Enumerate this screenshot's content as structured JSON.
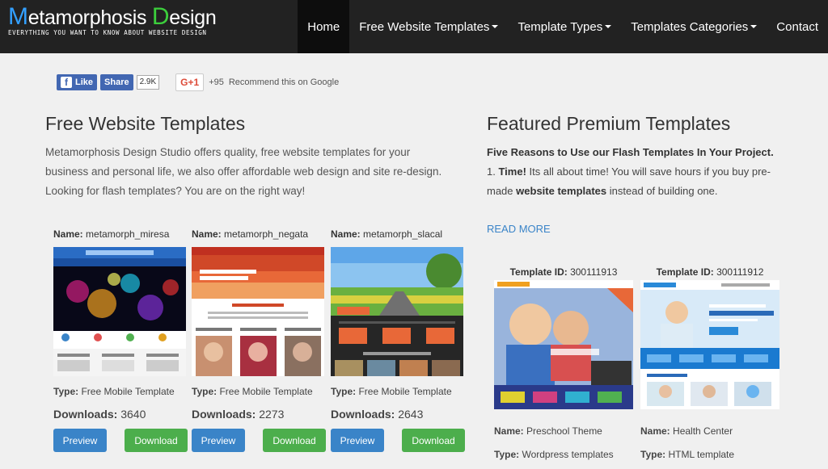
{
  "header": {
    "logo_m": "M",
    "logo_rest1": "etamorphosis ",
    "logo_d": "D",
    "logo_rest2": "esign",
    "tagline": "EVERYTHING YOU WANT TO KNOW ABOUT WEBSITE DESIGN",
    "nav": {
      "home": "Home",
      "free_templates": "Free Website Templates",
      "template_types": "Template Types",
      "template_categories": "Templates Categories",
      "contact": "Contact"
    }
  },
  "social": {
    "like": "Like",
    "share": "Share",
    "fb_count": "2.9K",
    "gplus": "G+1",
    "gplus_count": "+95",
    "gplus_text": "Recommend this on Google"
  },
  "left": {
    "heading": "Free Website Templates",
    "intro": "Metamorphosis Design Studio offers quality, free website templates for your business and personal life, we also offer affordable web design and site re-design. Looking for flash templates? You are on the right way!",
    "name_label": "Name:",
    "type_label": "Type:",
    "downloads_label": "Downloads:",
    "preview_label": "Preview",
    "download_label": "Download",
    "templates": [
      {
        "name": "metamorph_miresa",
        "type": "Free Mobile Template",
        "downloads": "3640"
      },
      {
        "name": "metamorph_negata",
        "type": "Free Mobile Template",
        "downloads": "2273"
      },
      {
        "name": "metamorph_slacal",
        "type": "Free Mobile Template",
        "downloads": "2643"
      }
    ]
  },
  "right": {
    "heading": "Featured Premium Templates",
    "feat_title": "Five Reasons to Use our Flash Templates In Your Project.",
    "feat_num": "1.",
    "feat_bold1": "Time!",
    "feat_text1": "Its all about time! You will save hours if you buy pre-made",
    "feat_bold2": "website templates",
    "feat_text2": "instead of building one.",
    "read_more": "READ MORE",
    "id_label": "Template ID:",
    "name_label": "Name:",
    "type_label": "Type:",
    "premium": [
      {
        "id": "300111913",
        "name": "Preschool Theme",
        "type": "Wordpress templates"
      },
      {
        "id": "300111912",
        "name": "Health Center",
        "type": "HTML template"
      }
    ]
  },
  "colors": {
    "header_bg": "#222222",
    "preview": "#3a84c8",
    "download": "#4cae4c",
    "link": "#3a84c8"
  }
}
